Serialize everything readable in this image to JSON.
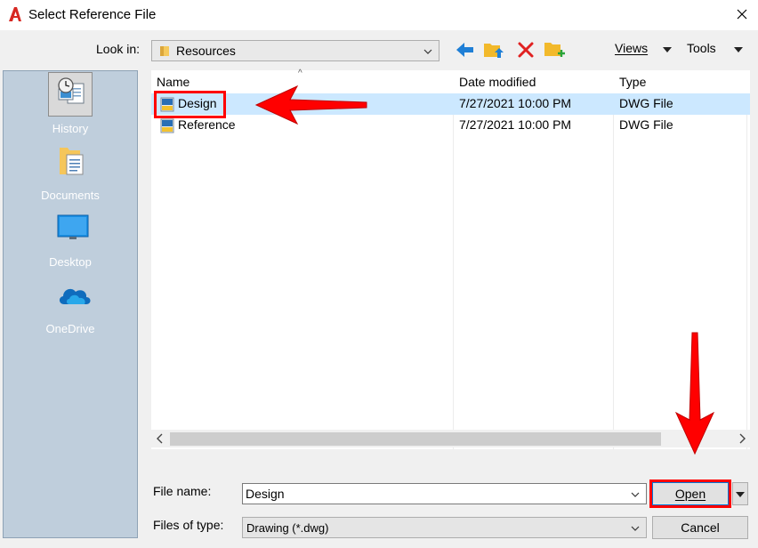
{
  "window": {
    "title": "Select Reference File"
  },
  "toolbar": {
    "look_in_label": "Look in:",
    "look_in_value": "Resources",
    "views_label": "Views",
    "tools_label": "Tools"
  },
  "places": [
    {
      "label": "History",
      "icon": "history-icon"
    },
    {
      "label": "Documents",
      "icon": "documents-folder-icon"
    },
    {
      "label": "Desktop",
      "icon": "desktop-icon"
    },
    {
      "label": "OneDrive",
      "icon": "onedrive-cloud-icon"
    }
  ],
  "file_list": {
    "columns": [
      "Name",
      "Date modified",
      "Type"
    ],
    "rows": [
      {
        "name": "Design",
        "date": "7/27/2021 10:00 PM",
        "type": "DWG File",
        "selected": true
      },
      {
        "name": "Reference",
        "date": "7/27/2021 10:00 PM",
        "type": "DWG File",
        "selected": false
      }
    ]
  },
  "bottom": {
    "file_name_label": "File name:",
    "file_name_value": "Design",
    "files_of_type_label": "Files of type:",
    "files_of_type_value": "Drawing (*.dwg)",
    "open_label": "Open",
    "cancel_label": "Cancel"
  },
  "colors": {
    "selection": "#cce8ff",
    "sidebar": "#bfcedc",
    "annotation": "#ff0000",
    "accent": "#0078d7"
  }
}
